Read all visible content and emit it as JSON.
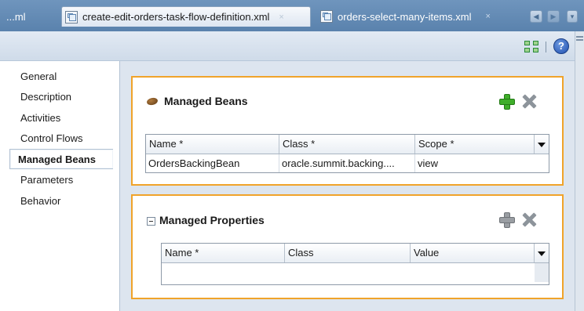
{
  "tabs": {
    "overflow_label": "...ml",
    "active_label": "create-edit-orders-task-flow-definition.xml",
    "inactive_label": "orders-select-many-items.xml",
    "close_glyph": "×"
  },
  "toolbar": {
    "help_label": "?"
  },
  "nav": {
    "items": [
      "General",
      "Description",
      "Activities",
      "Control Flows",
      "Managed Beans",
      "Parameters",
      "Behavior"
    ],
    "selected": "Managed Beans"
  },
  "managed_beans": {
    "title": "Managed Beans",
    "columns": [
      "Name *",
      "Class *",
      "Scope *"
    ],
    "rows": [
      [
        "OrdersBackingBean",
        "oracle.summit.backing....",
        "view"
      ]
    ]
  },
  "managed_properties": {
    "title": "Managed Properties",
    "columns": [
      "Name *",
      "Class",
      "Value"
    ],
    "rows": []
  },
  "colors": {
    "section_border": "#f0a32a",
    "add_icon": "#3fae2a",
    "tabstrip": "#5a82ad"
  }
}
